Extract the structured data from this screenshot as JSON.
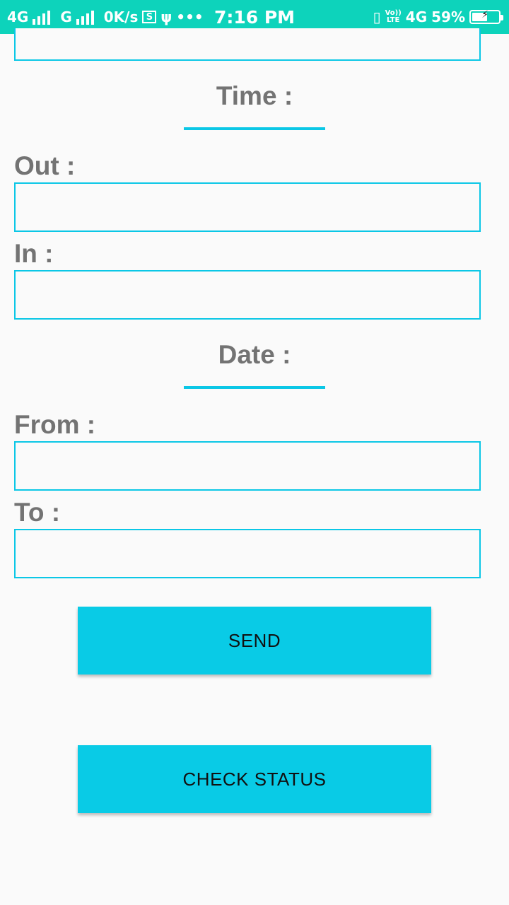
{
  "status_bar": {
    "network1": "4G",
    "network2": "G",
    "speed": "0K/s",
    "time": "7:16 PM",
    "volte_top": "Vo))",
    "volte_bottom": "LTE",
    "network3": "4G",
    "battery_percent": "59%",
    "battery_level": 0.59,
    "color": "#0dd3bb"
  },
  "form": {
    "time_section_title": "Time :",
    "out_label": "Out :",
    "out_value": "",
    "in_label": "In :",
    "in_value": "",
    "date_section_title": "Date :",
    "from_label": "From :",
    "from_value": "",
    "to_label": "To :",
    "to_value": "",
    "top_field_value": ""
  },
  "buttons": {
    "send_label": "SEND",
    "check_status_label": "CHECK STATUS"
  },
  "colors": {
    "accent": "#0bc7e6",
    "button": "#09cbe6",
    "label": "#737373",
    "background": "#fafafa"
  }
}
